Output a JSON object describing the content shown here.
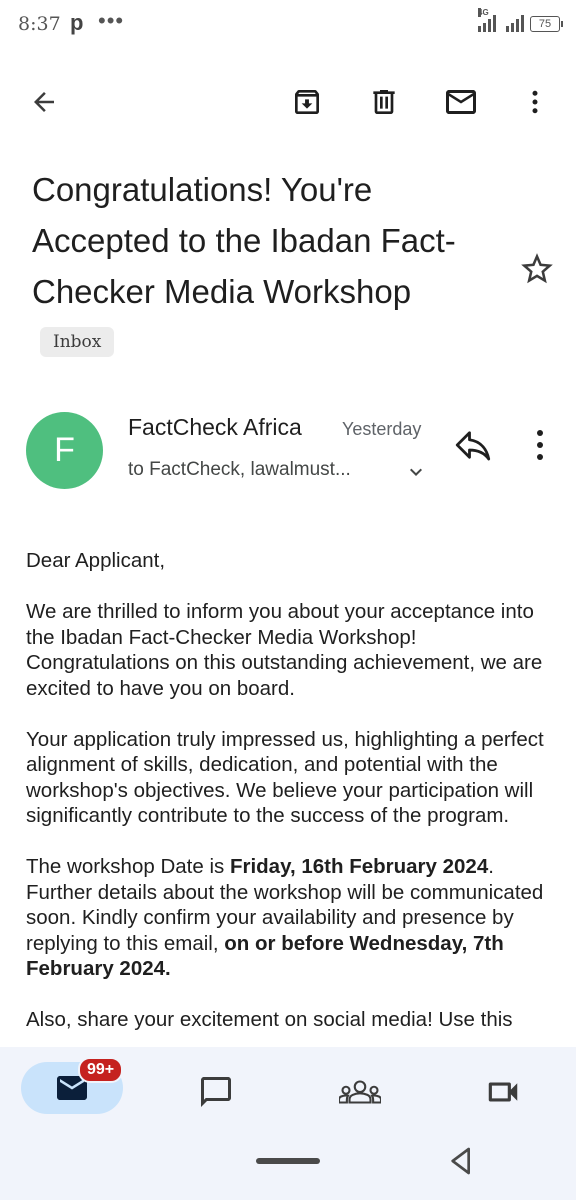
{
  "status_bar": {
    "time": "8:37",
    "app_letter": "p",
    "dots": "•••",
    "network": "4G",
    "battery": "75"
  },
  "toolbar": {
    "back_icon": "arrow-back-icon",
    "archive_icon": "archive-icon",
    "delete_icon": "trash-icon",
    "mark_unread_icon": "mail-icon",
    "more_icon": "more-vert-icon"
  },
  "email": {
    "subject": "Congratulations! You're Accepted to the Ibadan Fact-Checker Media Workshop",
    "label": "Inbox",
    "sender": {
      "initial": "F",
      "name": "FactCheck Africa",
      "date": "Yesterday",
      "to": "to FactCheck, lawalmust...",
      "avatar_color": "#4fbf7f"
    },
    "body": {
      "greeting": "Dear Applicant,",
      "p1": "We are thrilled to inform you about your acceptance into the Ibadan Fact-Checker Media Workshop! Congratulations on this outstanding achievement, we are excited to have you on board.",
      "p2": "Your application truly impressed us, highlighting a perfect alignment of skills, dedication, and potential with the workshop's objectives. We believe your participation will significantly contribute to the success of the program.",
      "p3_a": "The workshop Date is ",
      "p3_date": "Friday, 16th February 2024",
      "p3_b": ". Further details about the workshop will be communicated soon. Kindly confirm your availability and presence by replying to this email, ",
      "p3_deadline": "on or before Wednesday, 7th February 2024.",
      "p4_partial": "Also, share your excitement on social media! Use this"
    }
  },
  "bottom_nav": {
    "mail_badge": "99+",
    "accent_color": "#c9e3fb",
    "badge_color": "#c5221f"
  }
}
